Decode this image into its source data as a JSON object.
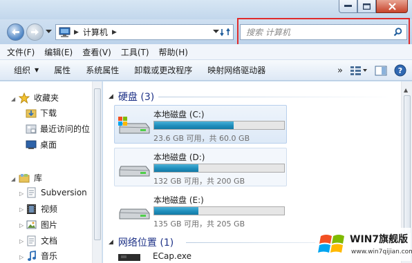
{
  "addressbar": {
    "location": "计算机",
    "search_placeholder": "搜索 计算机"
  },
  "menu": [
    "文件(F)",
    "编辑(E)",
    "查看(V)",
    "工具(T)",
    "帮助(H)"
  ],
  "toolbar": {
    "organize": "组织",
    "properties": "属性",
    "system_properties": "系统属性",
    "uninstall": "卸载或更改程序",
    "map_drive": "映射网络驱动器",
    "more": "»"
  },
  "sidebar": {
    "favorites": "收藏夹",
    "downloads": "下载",
    "recent": "最近访问的位",
    "desktop": "桌面",
    "libraries": "库",
    "subversion": "Subversion",
    "videos": "视频",
    "pictures": "图片",
    "documents": "文档",
    "music": "音乐"
  },
  "main": {
    "hard_disks_header": "硬盘 (3)",
    "drives": [
      {
        "name": "本地磁盘 (C:)",
        "info": "23.6 GB 可用，共 60.0 GB",
        "used_fraction": 0.61
      },
      {
        "name": "本地磁盘 (D:)",
        "info": "132 GB 可用，共 200 GB",
        "used_fraction": 0.34
      },
      {
        "name": "本地磁盘 (E:)",
        "info": "135 GB 可用，共 205 GB",
        "used_fraction": 0.34
      }
    ],
    "network_header": "网络位置 (1)",
    "network_item": "ECap.exe"
  },
  "watermark": {
    "title": "WIN7旗舰版",
    "url": "www.win7qijian.com"
  },
  "colors": {
    "highlight_border": "#e02a2a",
    "group_header": "#1e3287",
    "disk_bar": "#1f8ebc"
  }
}
